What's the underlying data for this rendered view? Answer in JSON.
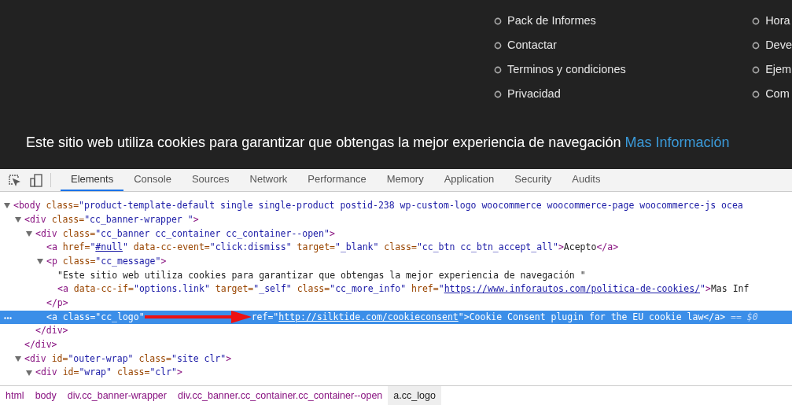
{
  "site_menu": {
    "columns": [
      {
        "items": [
          "Pack de Informes",
          "Contactar",
          "Terminos y condiciones",
          "Privacidad"
        ]
      },
      {
        "items": [
          "Hora",
          "Deve",
          "Ejem",
          "Com"
        ]
      }
    ]
  },
  "cookie_banner": {
    "message": "Este sitio web utiliza cookies para garantizar que obtengas la mejor experiencia de navegación",
    "link": "Mas Información"
  },
  "devtools": {
    "tabs": [
      {
        "label": "Elements",
        "selected": true
      },
      {
        "label": "Console",
        "selected": false
      },
      {
        "label": "Sources",
        "selected": false
      },
      {
        "label": "Network",
        "selected": false
      },
      {
        "label": "Performance",
        "selected": false
      },
      {
        "label": "Memory",
        "selected": false
      },
      {
        "label": "Application",
        "selected": false
      },
      {
        "label": "Security",
        "selected": false
      },
      {
        "label": "Audits",
        "selected": false
      }
    ],
    "dom_tree": [
      {
        "expanded": true,
        "selected": false,
        "tokens": [
          {
            "kind": "tag",
            "text": "<body"
          },
          {
            "kind": "attr",
            "text": " class="
          },
          {
            "kind": "value",
            "text": "\"product-template-default single single-product postid-238 wp-custom-logo woocommerce woocommerce-page woocommerce-js ocea"
          }
        ],
        "children": [
          {
            "expanded": true,
            "selected": false,
            "tokens": [
              {
                "kind": "tag",
                "text": "<div"
              },
              {
                "kind": "attr",
                "text": " class="
              },
              {
                "kind": "value",
                "text": "\"cc_banner-wrapper \""
              },
              {
                "kind": "tag",
                "text": ">"
              }
            ],
            "closing": [
              {
                "kind": "tag",
                "text": "</div>"
              }
            ],
            "children": [
              {
                "expanded": true,
                "selected": false,
                "tokens": [
                  {
                    "kind": "tag",
                    "text": "<div"
                  },
                  {
                    "kind": "attr",
                    "text": " class="
                  },
                  {
                    "kind": "value",
                    "text": "\"cc_banner cc_container cc_container--open\""
                  },
                  {
                    "kind": "tag",
                    "text": ">"
                  }
                ],
                "closing": [
                  {
                    "kind": "tag",
                    "text": "</div>"
                  }
                ],
                "children": [
                  {
                    "selected": false,
                    "tokens": [
                      {
                        "kind": "tag",
                        "text": "<a"
                      },
                      {
                        "kind": "attr",
                        "text": " href="
                      },
                      {
                        "kind": "value",
                        "text": "\""
                      },
                      {
                        "kind": "link",
                        "text": "#null"
                      },
                      {
                        "kind": "value",
                        "text": "\""
                      },
                      {
                        "kind": "attr",
                        "text": " data-cc-event="
                      },
                      {
                        "kind": "value",
                        "text": "\"click:dismiss\""
                      },
                      {
                        "kind": "attr",
                        "text": " target="
                      },
                      {
                        "kind": "value",
                        "text": "\"_blank\""
                      },
                      {
                        "kind": "attr",
                        "text": " class="
                      },
                      {
                        "kind": "value",
                        "text": "\"cc_btn cc_btn_accept_all\""
                      },
                      {
                        "kind": "tag",
                        "text": ">"
                      },
                      {
                        "kind": "text",
                        "text": "Acepto"
                      },
                      {
                        "kind": "tag",
                        "text": "</a>"
                      }
                    ]
                  },
                  {
                    "expanded": true,
                    "selected": false,
                    "tokens": [
                      {
                        "kind": "tag",
                        "text": "<p"
                      },
                      {
                        "kind": "attr",
                        "text": " class="
                      },
                      {
                        "kind": "value",
                        "text": "\"cc_message\""
                      },
                      {
                        "kind": "tag",
                        "text": ">"
                      }
                    ],
                    "closing": [
                      {
                        "kind": "tag",
                        "text": "</p>"
                      }
                    ],
                    "children": [
                      {
                        "selected": false,
                        "tokens": [
                          {
                            "kind": "text",
                            "text": "\"Este sitio web utiliza cookies para garantizar que obtengas la mejor experiencia de navegación \""
                          }
                        ]
                      },
                      {
                        "selected": false,
                        "tokens": [
                          {
                            "kind": "tag",
                            "text": "<a"
                          },
                          {
                            "kind": "attr",
                            "text": " data-cc-if="
                          },
                          {
                            "kind": "value",
                            "text": "\"options.link\""
                          },
                          {
                            "kind": "attr",
                            "text": " target="
                          },
                          {
                            "kind": "value",
                            "text": "\"_self\""
                          },
                          {
                            "kind": "attr",
                            "text": " class="
                          },
                          {
                            "kind": "value",
                            "text": "\"cc_more_info\""
                          },
                          {
                            "kind": "attr",
                            "text": " href="
                          },
                          {
                            "kind": "value",
                            "text": "\""
                          },
                          {
                            "kind": "link",
                            "text": "https://www.inforautos.com/politica-de-cookies/"
                          },
                          {
                            "kind": "value",
                            "text": "\""
                          },
                          {
                            "kind": "tag",
                            "text": ">"
                          },
                          {
                            "kind": "text",
                            "text": "Mas Inf"
                          }
                        ]
                      }
                    ]
                  },
                  {
                    "selected": true,
                    "tokens": [
                      {
                        "kind": "tag",
                        "text": "<a"
                      },
                      {
                        "kind": "attr",
                        "text": " class="
                      },
                      {
                        "kind": "value",
                        "text": "\"cc_logo\""
                      },
                      {
                        "kind": "arrow"
                      },
                      {
                        "kind": "attr",
                        "text": "ref="
                      },
                      {
                        "kind": "value",
                        "text": "\""
                      },
                      {
                        "kind": "link",
                        "text": "http://silktide.com/cookieconsent"
                      },
                      {
                        "kind": "value",
                        "text": "\""
                      },
                      {
                        "kind": "tag",
                        "text": ">"
                      },
                      {
                        "kind": "text",
                        "text": "Cookie Consent plugin for the EU cookie law"
                      },
                      {
                        "kind": "tag",
                        "text": "</a>"
                      },
                      {
                        "kind": "marker",
                        "text": " == $0"
                      }
                    ]
                  }
                ]
              }
            ]
          },
          {
            "expanded": true,
            "selected": false,
            "tokens": [
              {
                "kind": "tag",
                "text": "<div"
              },
              {
                "kind": "attr",
                "text": " id="
              },
              {
                "kind": "value",
                "text": "\"outer-wrap\""
              },
              {
                "kind": "attr",
                "text": " class="
              },
              {
                "kind": "value",
                "text": "\"site clr\""
              },
              {
                "kind": "tag",
                "text": ">"
              }
            ],
            "children": [
              {
                "expanded": true,
                "selected": false,
                "tokens": [
                  {
                    "kind": "tag",
                    "text": "<div"
                  },
                  {
                    "kind": "attr",
                    "text": " id="
                  },
                  {
                    "kind": "value",
                    "text": "\"wrap\""
                  },
                  {
                    "kind": "attr",
                    "text": " class="
                  },
                  {
                    "kind": "value",
                    "text": "\"clr\""
                  },
                  {
                    "kind": "tag",
                    "text": ">"
                  }
                ]
              }
            ]
          }
        ]
      }
    ],
    "breadcrumbs": [
      {
        "label": "html",
        "selected": false
      },
      {
        "label": "body",
        "selected": false
      },
      {
        "label": "div.cc_banner-wrapper",
        "selected": false
      },
      {
        "label": "div.cc_banner.cc_container.cc_container--open",
        "selected": false
      },
      {
        "label": "a.cc_logo",
        "selected": true
      }
    ]
  }
}
